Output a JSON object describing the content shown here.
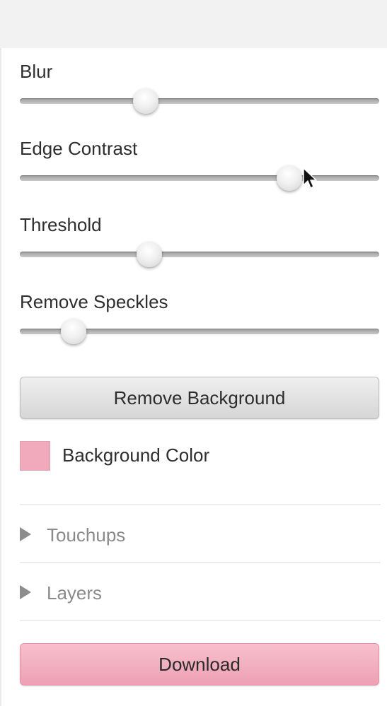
{
  "sliders": [
    {
      "label": "Blur",
      "value": 0.35
    },
    {
      "label": "Edge Contrast",
      "value": 0.75
    },
    {
      "label": "Threshold",
      "value": 0.36
    },
    {
      "label": "Remove Speckles",
      "value": 0.15
    }
  ],
  "actions": {
    "remove_background_label": "Remove Background",
    "download_label": "Download"
  },
  "background_color": {
    "label": "Background Color",
    "value": "#f0aabc"
  },
  "sections": [
    {
      "label": "Touchups",
      "icon": "triangle-right-icon"
    },
    {
      "label": "Layers",
      "icon": "triangle-right-icon"
    }
  ],
  "colors": {
    "accent": "#f0aabc",
    "download_button": "#f2b1c1"
  }
}
